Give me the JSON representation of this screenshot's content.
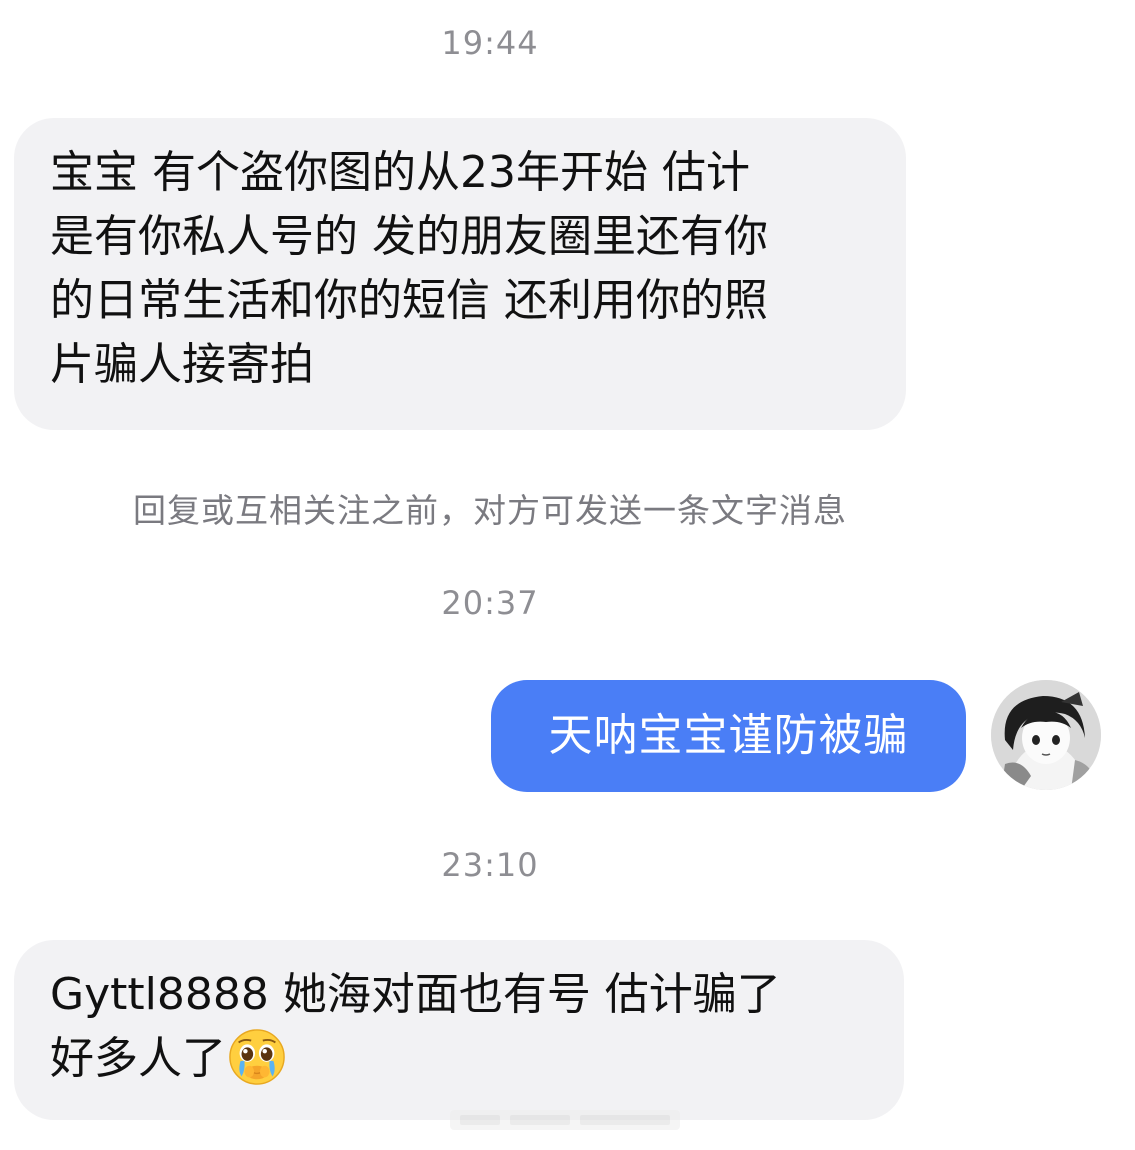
{
  "conversation": {
    "time_1": "19:44",
    "incoming_1": {
      "lines": [
        "宝宝 有个盗你图的从23年开始 估计",
        "是有你私人号的 发的朋友圈里还有你",
        "的日常生活和你的短信 还利用你的照",
        "片骗人接寄拍"
      ]
    },
    "system_note": "回复或互相关注之前，对方可发送一条文字消息",
    "time_2": "20:37",
    "outgoing_1": {
      "text": "天呐宝宝谨防被骗"
    },
    "time_3": "23:10",
    "incoming_2": {
      "line_1": "Gyttl8888 她海对面也有号 估计骗了",
      "line_2": "好多人了",
      "emoji": "pleading-crying-face-icon"
    }
  },
  "colors": {
    "incoming_bubble": "#f2f2f4",
    "outgoing_bubble": "#4a7ef6",
    "timestamp_text": "#8e8e93"
  }
}
